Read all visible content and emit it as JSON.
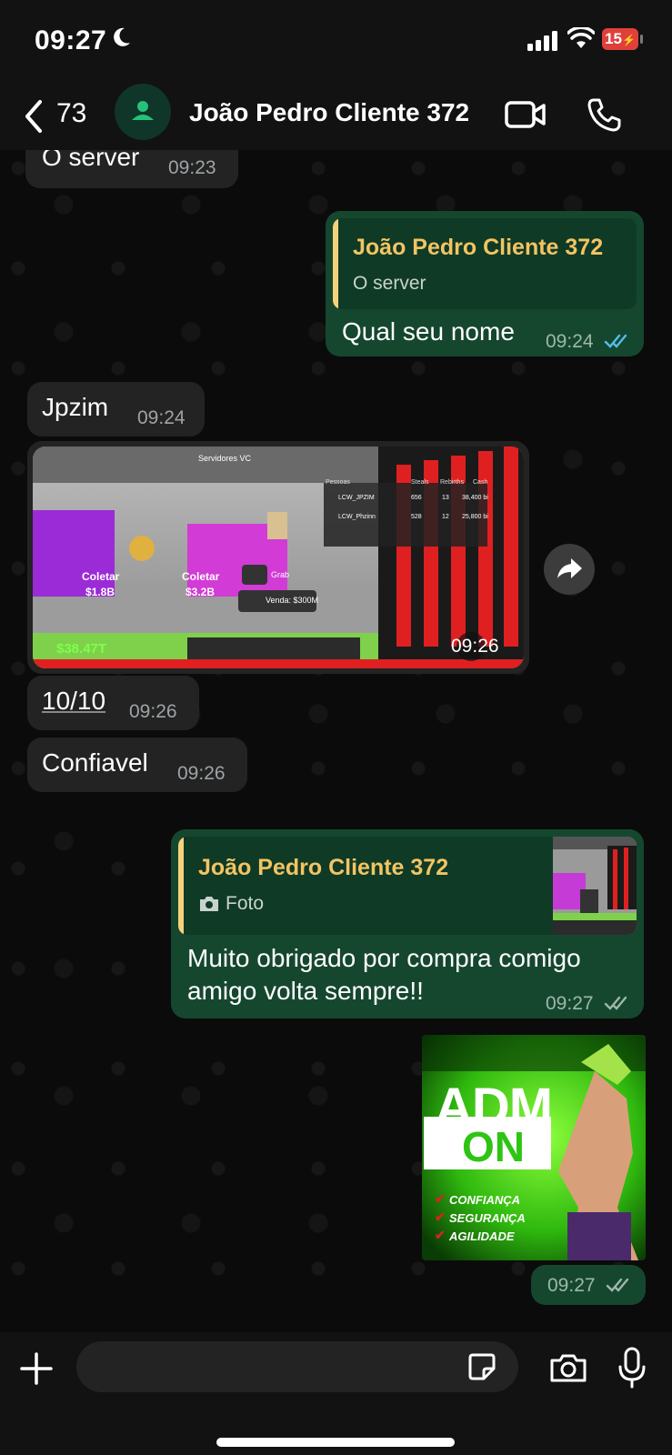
{
  "status": {
    "time": "09:27",
    "battery": "15"
  },
  "header": {
    "back_count": "73",
    "contact_name": "João Pedro Cliente 372"
  },
  "messages": {
    "m1": {
      "text": "O server",
      "time": "09:23"
    },
    "m2": {
      "quote_name": "João Pedro Cliente 372",
      "quote_text": "O server",
      "text": "Qual seu nome",
      "time": "09:24"
    },
    "m3": {
      "text": "Jpzim",
      "time": "09:24"
    },
    "m4": {
      "time": "09:26",
      "game": {
        "top_label": "Servidores VC",
        "col_people": "Pessoas",
        "col_steals": "Steals",
        "col_rebirths": "Rebirths",
        "col_cash": "Cash",
        "row1": [
          "LCW_JPZIM",
          "656",
          "13",
          "38,400 bi"
        ],
        "row2": [
          "LCW_Phzinn",
          "528",
          "12",
          "25,800 bi"
        ],
        "coletar1": "Coletar",
        "val1": "$1.8B",
        "coletar2": "Coletar",
        "val2": "$3.2B",
        "grab": "Grab",
        "venda": "Venda: $300M",
        "money": "$38.47T"
      }
    },
    "m5": {
      "text": "10/10",
      "time": "09:26"
    },
    "m6": {
      "text": "Confiavel",
      "time": "09:26"
    },
    "m7": {
      "quote_name": "João Pedro Cliente 372",
      "quote_text": "Foto",
      "line1": "Muito obrigado por compra comigo",
      "line2": "amigo volta sempre!!",
      "time": "09:27"
    },
    "m8": {
      "time": "09:27",
      "poster": {
        "adm": "ADM",
        "on": "ON",
        "item1": "CONFIANÇA",
        "item2": "SEGURANÇA",
        "item3": "AGILIDADE"
      }
    }
  },
  "colors": {
    "outgoing": "#15472f",
    "incoming": "#232323",
    "quote_name": "#f3c462",
    "read_ticks": "#53bdeb"
  }
}
